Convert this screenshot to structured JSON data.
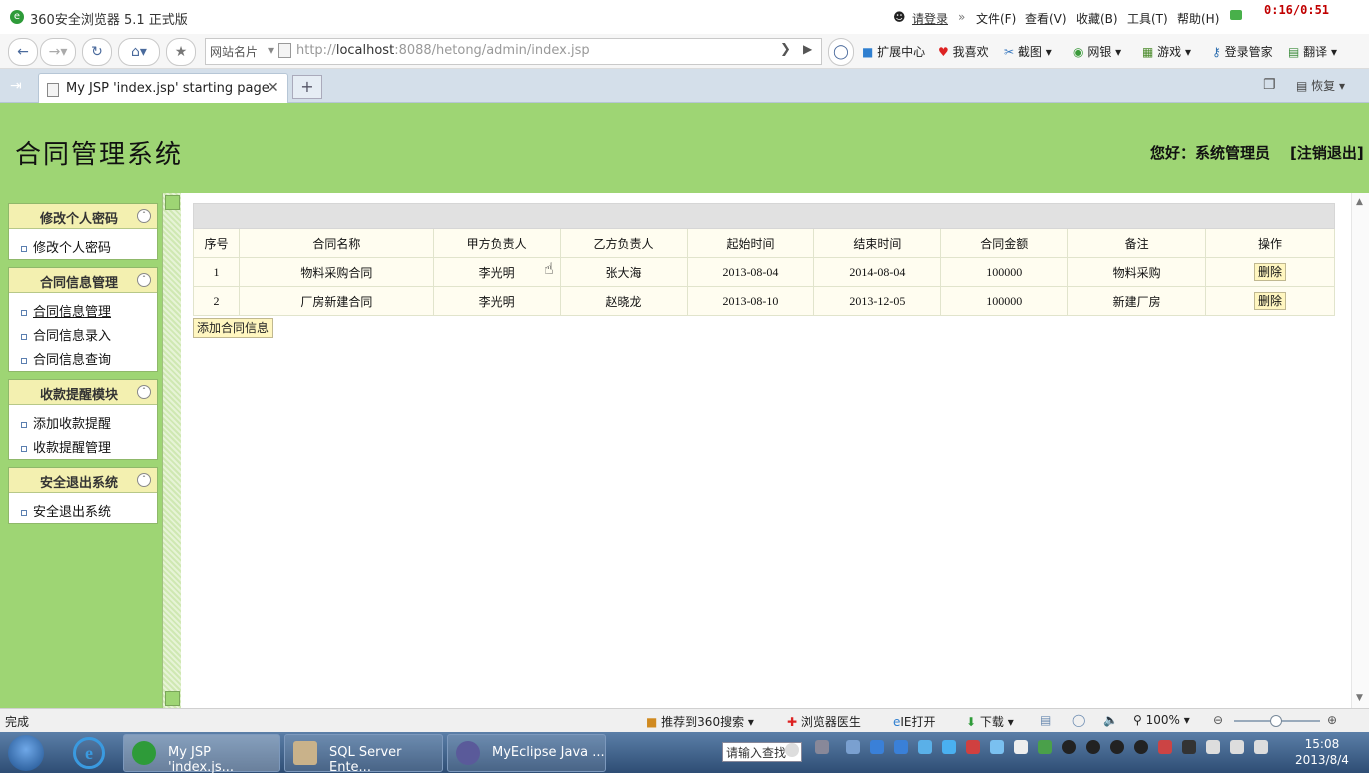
{
  "browser": {
    "title": "360安全浏览器 5.1 正式版",
    "login_link": "请登录",
    "menu": [
      "文件(F)",
      "查看(V)",
      "收藏(B)",
      "工具(T)",
      "帮助(H)"
    ],
    "timer": "0:16/0:51",
    "site_card": "网站名片",
    "url_prefix": "http://",
    "url_host": "localhost",
    "url_rest": ":8088/hetong/admin/index.jsp",
    "toolbar": [
      "扩展中心",
      "我喜欢",
      "截图",
      "网银",
      "游戏",
      "登录管家",
      "翻译"
    ],
    "tab_title": "My JSP 'index.jsp' starting page",
    "restore": "恢复"
  },
  "app": {
    "title": "合同管理系统",
    "greeting": "您好：系统管理员",
    "logout": "[注销退出]"
  },
  "sidebar": {
    "panels": [
      {
        "title": "修改个人密码",
        "items": [
          "修改个人密码"
        ]
      },
      {
        "title": "合同信息管理",
        "items": [
          "合同信息管理",
          "合同信息录入",
          "合同信息查询"
        ]
      },
      {
        "title": "收款提醒模块",
        "items": [
          "添加收款提醒",
          "收款提醒管理"
        ]
      },
      {
        "title": "安全退出系统",
        "items": [
          "安全退出系统"
        ]
      }
    ]
  },
  "table": {
    "headers": [
      "序号",
      "合同名称",
      "甲方负责人",
      "乙方负责人",
      "起始时间",
      "结束时间",
      "合同金额",
      "备注",
      "操作"
    ],
    "rows": [
      [
        "1",
        "物料采购合同",
        "李光明",
        "张大海",
        "2013-08-04",
        "2014-08-04",
        "100000",
        "物料采购"
      ],
      [
        "2",
        "厂房新建合同",
        "李光明",
        "赵晓龙",
        "2013-08-10",
        "2013-12-05",
        "100000",
        "新建厂房"
      ]
    ],
    "delete_label": "删除",
    "add_label": "添加合同信息"
  },
  "statusbar": {
    "status": "完成",
    "items": [
      "推荐到360搜索",
      "浏览器医生",
      "IE打开",
      "下载"
    ],
    "zoom": "100%"
  },
  "taskbar": {
    "tasks": [
      "My JSP 'index.js...",
      "SQL Server Ente...",
      "MyEclipse Java ..."
    ],
    "search_placeholder": "请输入查找",
    "time": "15:08",
    "date": "2013/8/4"
  }
}
